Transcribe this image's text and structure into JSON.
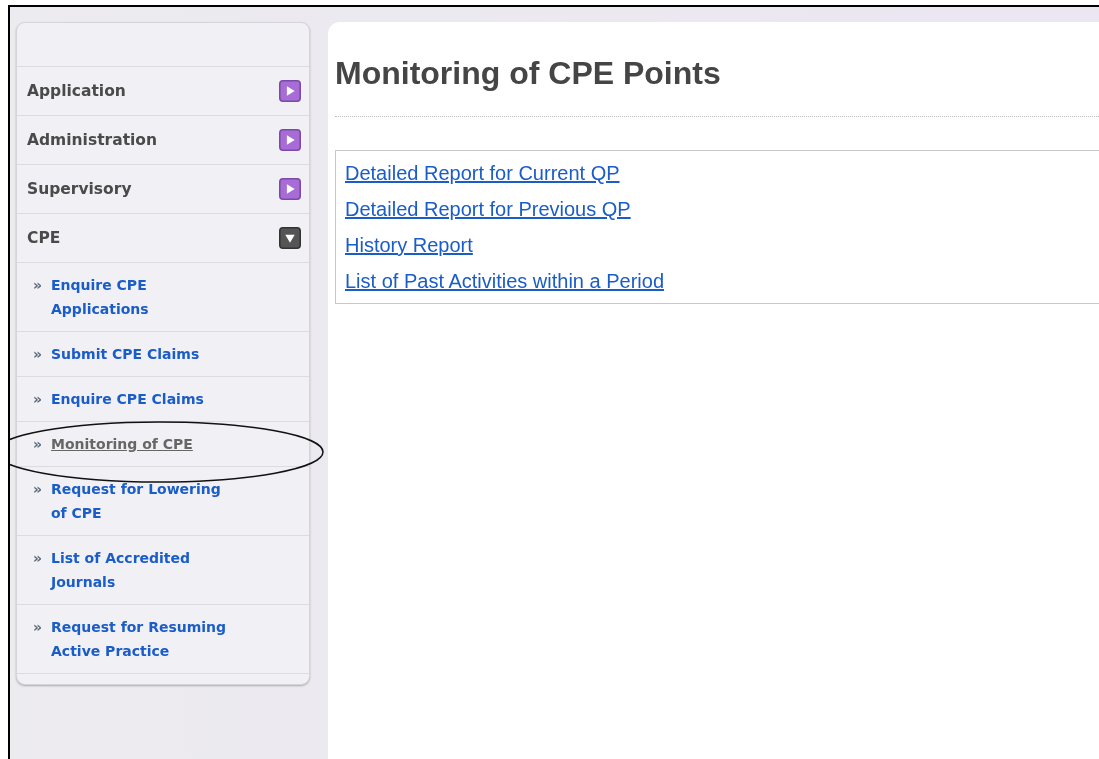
{
  "sidebar": {
    "menu": [
      {
        "label": "Application",
        "expanded": false
      },
      {
        "label": "Administration",
        "expanded": false
      },
      {
        "label": "Supervisory",
        "expanded": false
      },
      {
        "label": "CPE",
        "expanded": true,
        "children": [
          {
            "bullet": "»",
            "label": "Enquire CPE Applications",
            "selected": false,
            "circled": false
          },
          {
            "bullet": "»",
            "label": "Submit CPE Claims",
            "selected": false,
            "circled": false
          },
          {
            "bullet": "»",
            "label": "Enquire CPE Claims",
            "selected": false,
            "circled": false
          },
          {
            "bullet": "»",
            "label": "Monitoring of CPE",
            "selected": true,
            "circled": true
          },
          {
            "bullet": "»",
            "label": "Request for Lowering of CPE",
            "selected": false,
            "circled": false
          },
          {
            "bullet": "»",
            "label": "List of Accredited Journals",
            "selected": false,
            "circled": false
          },
          {
            "bullet": "»",
            "label": "Request for Resuming Active Practice",
            "selected": false,
            "circled": false
          }
        ]
      }
    ]
  },
  "main": {
    "title": "Monitoring of CPE Points",
    "links": [
      "Detailed Report for Current QP",
      "Detailed Report for Previous QP",
      "History Report",
      "List of Past Activities within a Period"
    ]
  }
}
